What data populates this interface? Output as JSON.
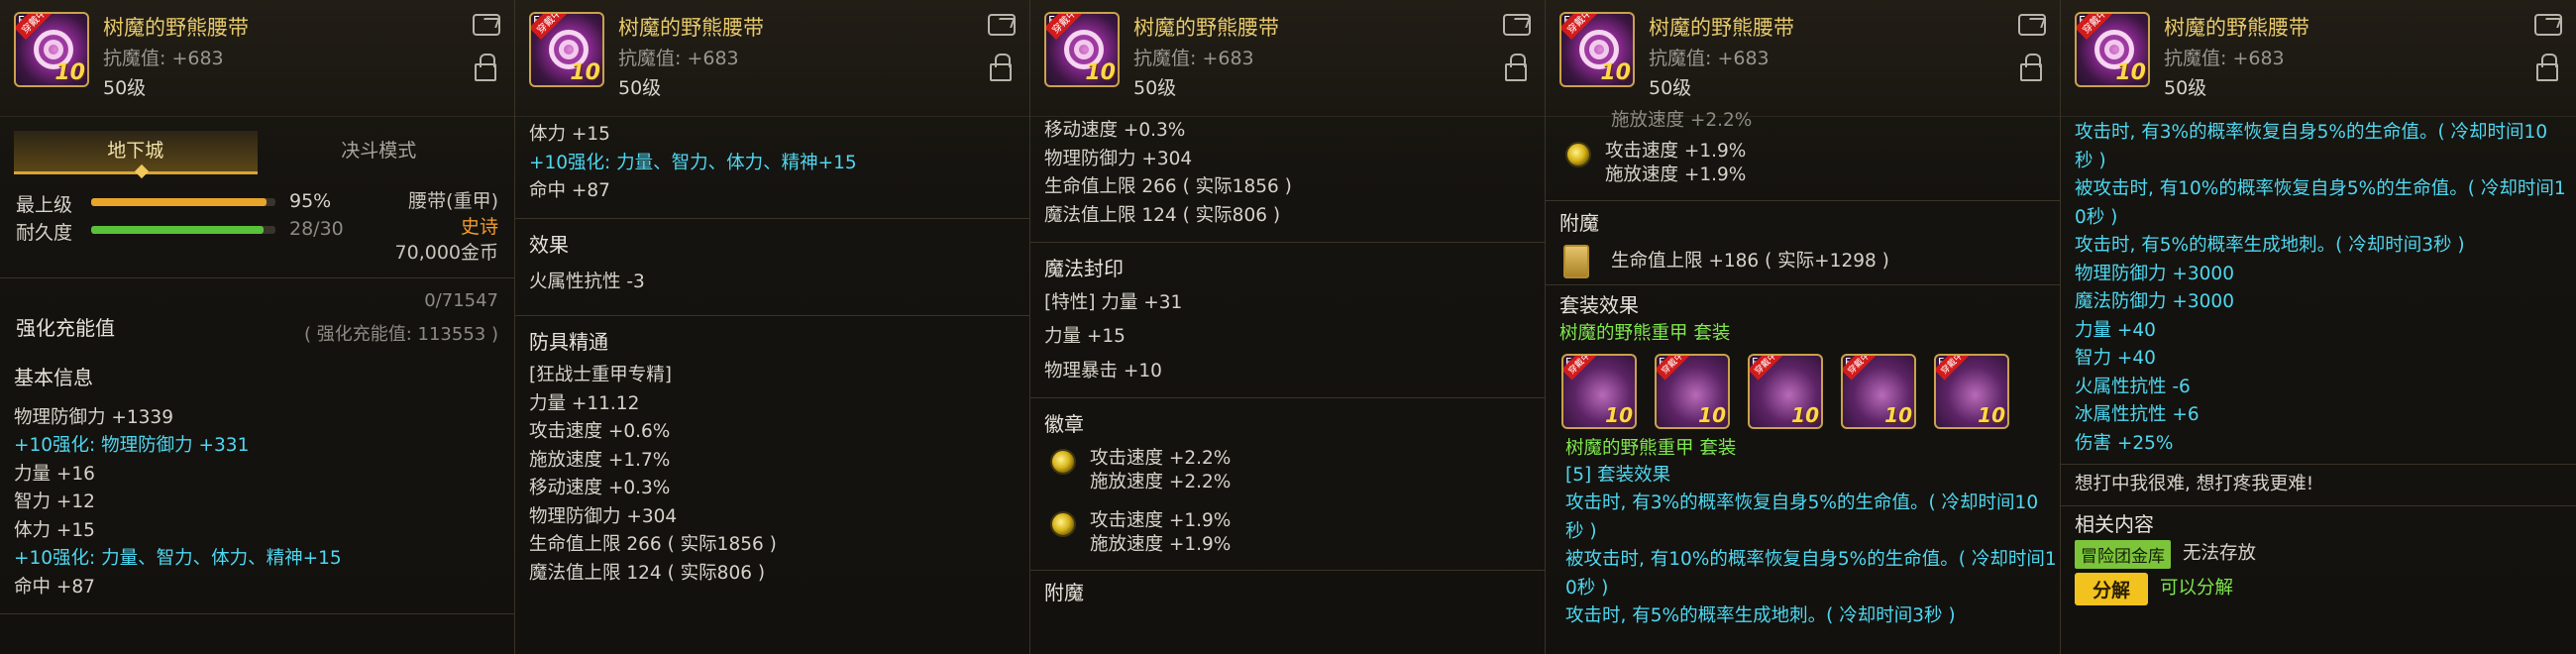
{
  "item": {
    "name": "树魔的野熊腰带",
    "anti_magic": "抗魔值: +683",
    "level": "50级",
    "icon_level": "10",
    "icon_tag": "F",
    "icon_ribbon": "穿戴中"
  },
  "panel1": {
    "tabs": [
      "地下城",
      "决斗模式"
    ],
    "bars": [
      {
        "label": "最上级",
        "value": "95%",
        "fraction": 0.95,
        "color": "#e8a52a"
      },
      {
        "label": "耐久度",
        "value": "28/30",
        "fraction": 0.933,
        "color": "#58c23a"
      }
    ],
    "slot": "腰带(重甲)",
    "rarity": "史诗",
    "price": "70,000金币",
    "charge_label": "强化充能值",
    "charge_value": "0/71547",
    "charge_total": "( 强化充能值: 113553 )",
    "basic_info": "基本信息",
    "lines": [
      {
        "t": "物理防御力 +1339",
        "c": ""
      },
      {
        "t": "+10强化: 物理防御力 +331",
        "c": "cyan"
      },
      {
        "t": "力量 +16",
        "c": ""
      },
      {
        "t": "智力 +12",
        "c": ""
      },
      {
        "t": "体力 +15",
        "c": ""
      },
      {
        "t": "+10强化: 力量、智力、体力、精神+15",
        "c": "cyan"
      },
      {
        "t": "命中 +87",
        "c": ""
      }
    ]
  },
  "panel2": {
    "top": [
      {
        "t": "体力 +15",
        "c": ""
      },
      {
        "t": "+10强化: 力量、智力、体力、精神+15",
        "c": "cyan"
      },
      {
        "t": "命中 +87",
        "c": ""
      }
    ],
    "effect_title": "效果",
    "effect_line": "火属性抗性 -3",
    "mastery_title": "防具精通",
    "mastery": [
      "[狂战士重甲专精]",
      "力量 +11.12",
      "攻击速度 +0.6%",
      "施放速度 +1.7%",
      "移动速度 +0.3%",
      "物理防御力 +304",
      "生命值上限 266 ( 实际1856 )",
      "魔法值上限 124 ( 实际806 )"
    ]
  },
  "panel3": {
    "top": [
      "移动速度 +0.3%",
      "物理防御力 +304",
      "生命值上限 266 ( 实际1856 )",
      "魔法值上限 124 ( 实际806 )"
    ],
    "seal_title": "魔法封印",
    "seal": [
      "[特性] 力量 +31",
      "力量 +15",
      "物理暴击 +10"
    ],
    "emblem_title": "徽章",
    "emblems": [
      {
        "a": "攻击速度 +2.2%",
        "b": "施放速度 +2.2%"
      },
      {
        "a": "攻击速度 +1.9%",
        "b": "施放速度 +1.9%"
      }
    ],
    "enchant_title": "附魔"
  },
  "panel4": {
    "cut_line": "施放速度 +2.2%",
    "emblem": {
      "a": "攻击速度 +1.9%",
      "b": "施放速度 +1.9%"
    },
    "enchant_title": "附魔",
    "enchant_line": "生命值上限 +186 ( 实际+1298 )",
    "set_title": "套装效果",
    "set_name": "树魔的野熊重甲  套装",
    "set_icons": 5,
    "set_name2": "树魔的野熊重甲  套装",
    "set_count": "[5] 套装效果",
    "set_lines": [
      "攻击时, 有3%的概率恢复自身5%的生命值。( 冷却时间10",
      "秒 )",
      "被攻击时, 有10%的概率恢复自身5%的生命值。( 冷却时间1",
      "0秒 )",
      "攻击时, 有5%的概率生成地刺。( 冷却时间3秒 )"
    ]
  },
  "panel5": {
    "lines": [
      {
        "t": "攻击时, 有3%的概率恢复自身5%的生命值。( 冷却时间10",
        "c": "cyan"
      },
      {
        "t": "秒 )",
        "c": "cyan"
      },
      {
        "t": "被攻击时, 有10%的概率恢复自身5%的生命值。( 冷却时间1",
        "c": "cyan"
      },
      {
        "t": "0秒 )",
        "c": "cyan"
      },
      {
        "t": "攻击时, 有5%的概率生成地刺。( 冷却时间3秒 )",
        "c": "cyan"
      },
      {
        "t": "物理防御力 +3000",
        "c": "cyan"
      },
      {
        "t": "魔法防御力 +3000",
        "c": "cyan"
      },
      {
        "t": "力量 +40",
        "c": "cyan"
      },
      {
        "t": "智力 +40",
        "c": "cyan"
      },
      {
        "t": "火属性抗性 -6",
        "c": "cyan"
      },
      {
        "t": "冰属性抗性 +6",
        "c": "cyan"
      },
      {
        "t": "伤害 +25%",
        "c": "cyan"
      }
    ],
    "flavor": "想打中我很难, 想打疼我更难!",
    "related_title": "相关内容",
    "bank_badge": "冒险团金库",
    "bank_text": "无法存放",
    "disassemble_badge": "分解",
    "disassemble_text": "可以分解"
  }
}
